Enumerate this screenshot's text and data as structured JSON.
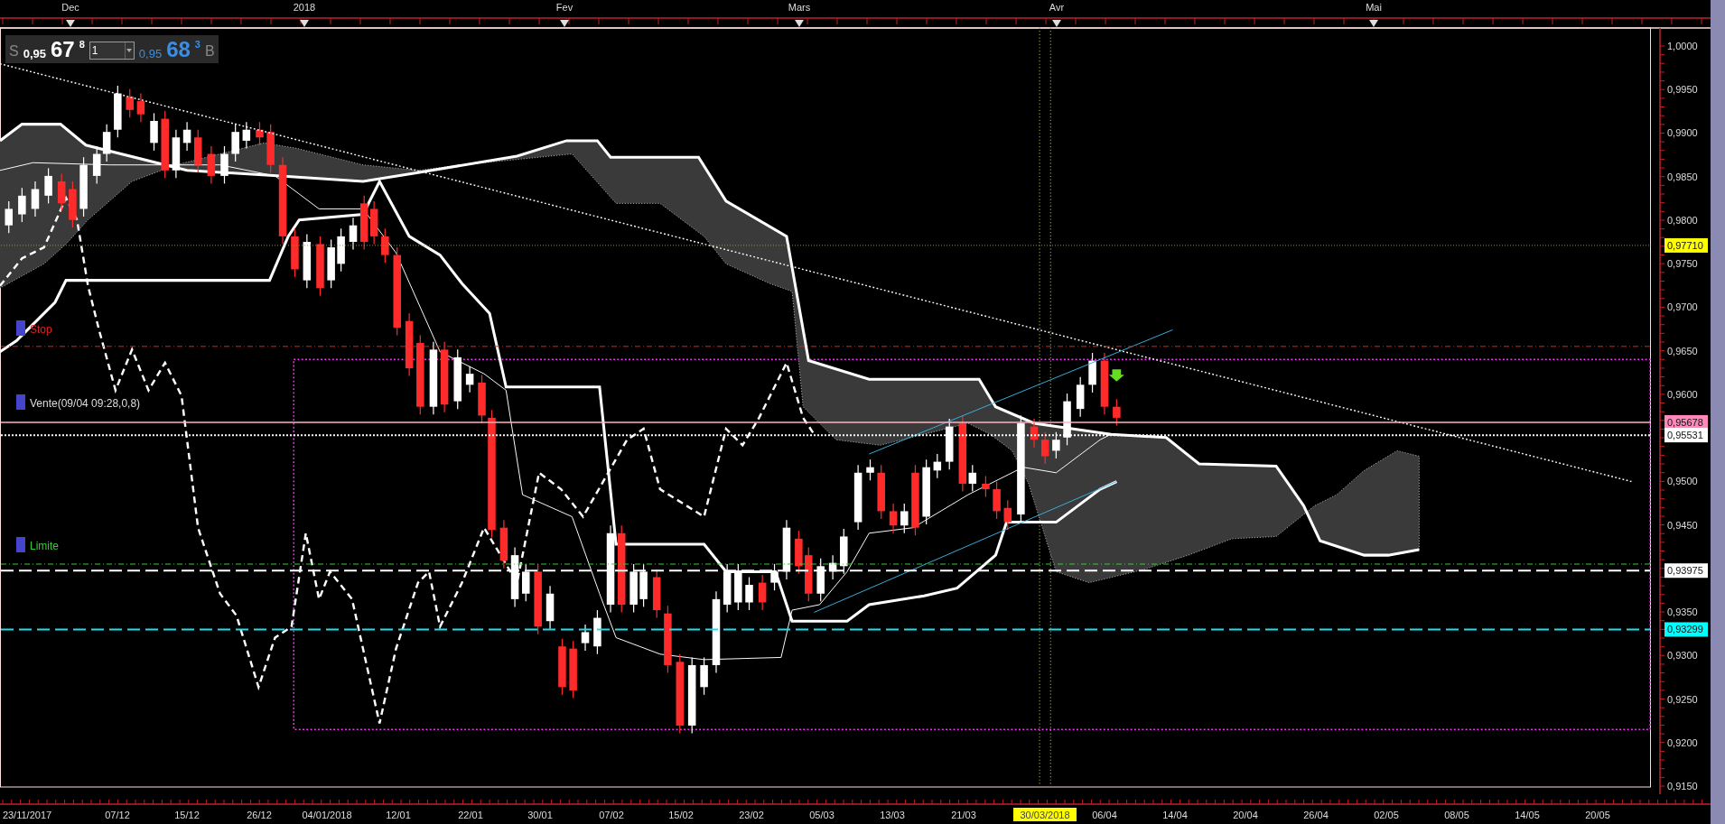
{
  "month_axis": {
    "labels": [
      "Dec",
      "2018",
      "Fev",
      "Mars",
      "Avr",
      "Mai"
    ]
  },
  "quote": {
    "sell_label": "S",
    "sell_prefix": "0,95",
    "sell_big": "67",
    "sell_sup": "8",
    "quantity": "1",
    "buy_prefix": "0,95",
    "buy_big": "68",
    "buy_sup": "3",
    "buy_label": "B"
  },
  "order_lines": [
    {
      "kind": "stop",
      "label": "Stop"
    },
    {
      "kind": "entry",
      "label": "Vente(09/04 09:28,0,8)"
    },
    {
      "kind": "limit",
      "label": "Limite"
    }
  ],
  "price_axis": {
    "labels": [
      "1,0000",
      "0,9950",
      "0,9900",
      "0,9850",
      "0,9800",
      "0,9750",
      "0,9700",
      "0,9650",
      "0,9600",
      "0,9500",
      "0,9450",
      "0,9350",
      "0,9300",
      "0,9250",
      "0,9200",
      "0,9150"
    ]
  },
  "price_markers": [
    {
      "label": "0,97710",
      "color": "#ffff00"
    },
    {
      "label": "0,95678",
      "color": "#ff88bb"
    },
    {
      "label": "0,95531",
      "color": "#ffffff"
    },
    {
      "label": "0,93975",
      "color": "#ffffff"
    },
    {
      "label": "0,93299",
      "color": "#00ffff"
    }
  ],
  "date_axis": {
    "labels": [
      {
        "label": "23/11/2017",
        "selected": false
      },
      {
        "label": "07/12",
        "selected": false
      },
      {
        "label": "15/12",
        "selected": false
      },
      {
        "label": "26/12",
        "selected": false
      },
      {
        "label": "04/01/2018",
        "selected": false
      },
      {
        "label": "12/01",
        "selected": false
      },
      {
        "label": "22/01",
        "selected": false
      },
      {
        "label": "30/01",
        "selected": false
      },
      {
        "label": "07/02",
        "selected": false
      },
      {
        "label": "15/02",
        "selected": false
      },
      {
        "label": "23/02",
        "selected": false
      },
      {
        "label": "05/03",
        "selected": false
      },
      {
        "label": "13/03",
        "selected": false
      },
      {
        "label": "21/03",
        "selected": false
      },
      {
        "label": "30/03/2018",
        "selected": true
      },
      {
        "label": "06/04",
        "selected": false
      },
      {
        "label": "14/04",
        "selected": false
      },
      {
        "label": "20/04",
        "selected": false
      },
      {
        "label": "26/04",
        "selected": false
      },
      {
        "label": "02/05",
        "selected": false
      },
      {
        "label": "08/05",
        "selected": false
      },
      {
        "label": "14/05",
        "selected": false
      },
      {
        "label": "20/05",
        "selected": false
      }
    ]
  }
}
